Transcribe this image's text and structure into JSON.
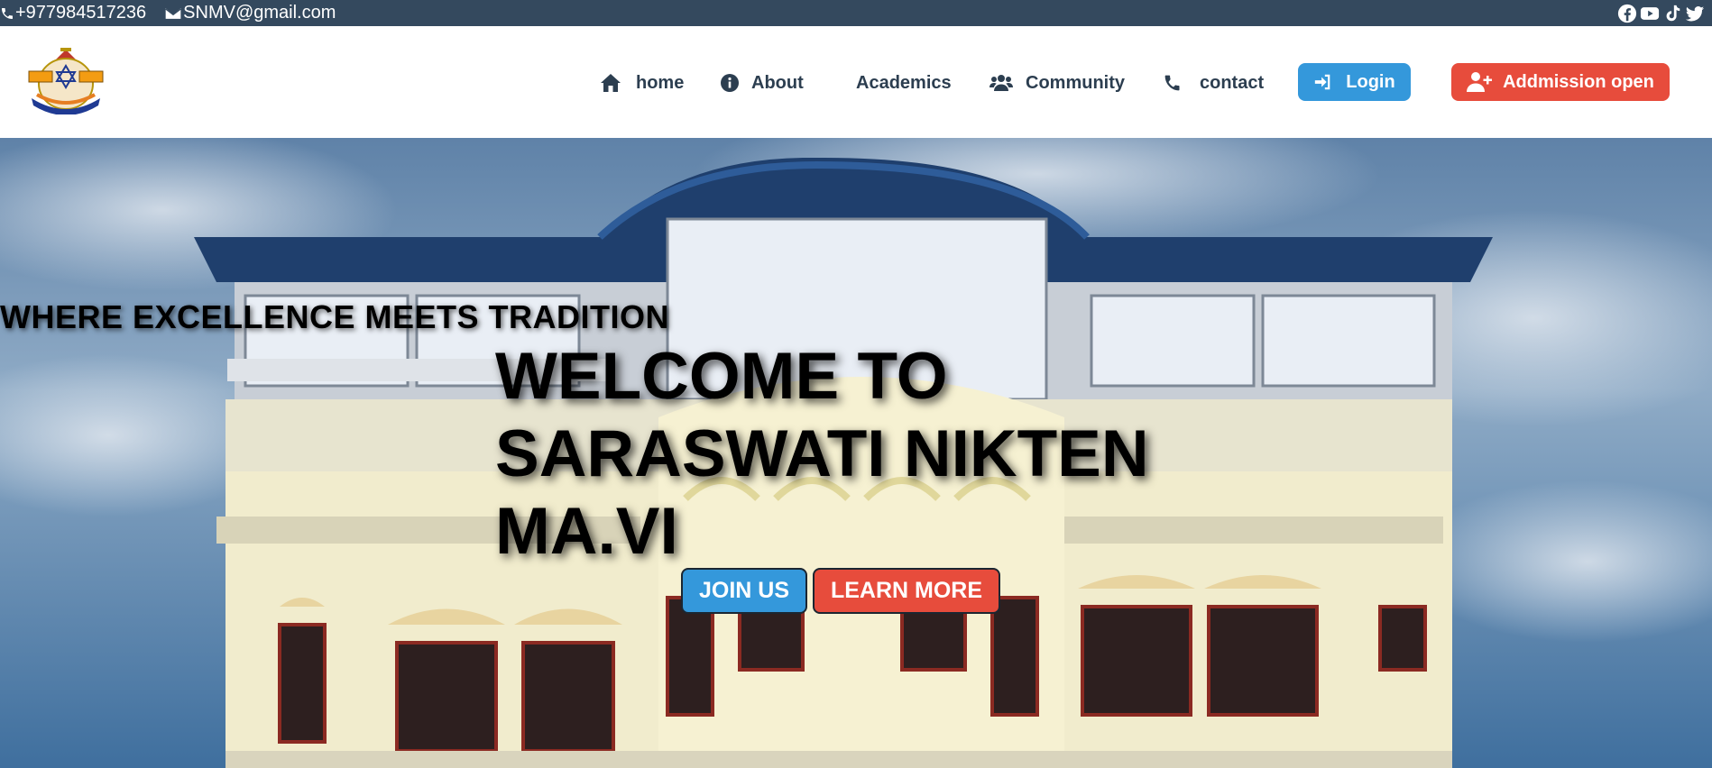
{
  "topbar": {
    "phone": "+977984517236",
    "email": "SNMV@gmail.com",
    "social_icons": [
      "facebook-icon",
      "youtube-icon",
      "tiktok-icon",
      "twitter-icon"
    ]
  },
  "navbar": {
    "items": [
      {
        "label": "home",
        "icon": "home-icon"
      },
      {
        "label": "About",
        "icon": "info-icon"
      },
      {
        "label": "Academics",
        "icon": ""
      },
      {
        "label": "Community",
        "icon": "users-icon"
      },
      {
        "label": "contact",
        "icon": "phone-icon"
      }
    ],
    "login_label": "Login",
    "admission_label": "Addmission open"
  },
  "hero": {
    "tagline": "WHERE EXCELLENCE MEETS TRADITION",
    "headline": "WELCOME TO SARASWATI NIKTEN MA.VI",
    "join_label": "JOIN US",
    "learn_label": "LEARN MORE"
  },
  "colors": {
    "topbar_bg": "#34495e",
    "nav_text": "#2c3e50",
    "primary_blue": "#3498db",
    "primary_red": "#e74c3c"
  }
}
